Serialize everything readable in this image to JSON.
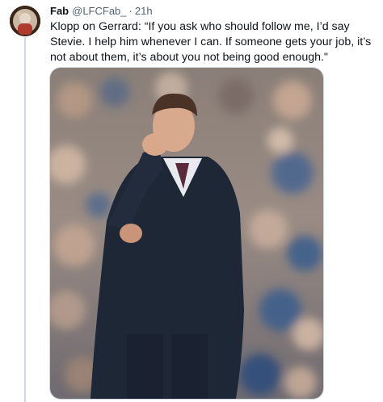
{
  "tweet": {
    "author_name": "Fab",
    "author_handle": "@LFCFab_",
    "separator": "·",
    "timestamp": "21h",
    "text": "Klopp on Gerrard: “If you ask who should follow me, I’d say Stevie. I help him whenever I can. If someone gets your job, it’s not about them, it’s about you not being good enough.\""
  },
  "icons": {
    "avatar": "profile-avatar",
    "media": "photo-of-man-in-dark-coat-in-stadium"
  },
  "colors": {
    "text_primary": "#0f1419",
    "text_secondary": "#536471",
    "divider": "#cfd9de",
    "coat": "#1e2736",
    "crowd_blue": "#3e5f8c"
  }
}
